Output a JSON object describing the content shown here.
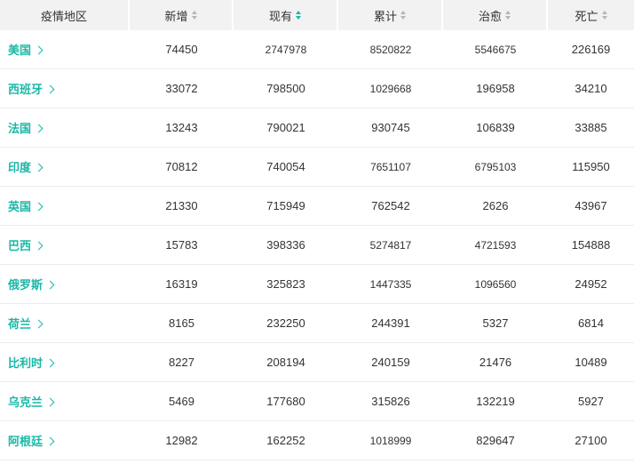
{
  "colors": {
    "accent": "#1ab8a8",
    "header_bg": "#f2f2f2",
    "text": "#333333",
    "row_border": "#ececec"
  },
  "table": {
    "columns": [
      {
        "label": "疫情地区",
        "sortable": false
      },
      {
        "label": "新增",
        "sortable": true,
        "active": false
      },
      {
        "label": "现有",
        "sortable": true,
        "active": true
      },
      {
        "label": "累计",
        "sortable": true,
        "active": false
      },
      {
        "label": "治愈",
        "sortable": true,
        "active": false
      },
      {
        "label": "死亡",
        "sortable": true,
        "active": false
      }
    ],
    "rows": [
      {
        "region": "美国",
        "new": "74450",
        "current": "2747978",
        "total": "8520822",
        "cured": "5546675",
        "dead": "226169"
      },
      {
        "region": "西班牙",
        "new": "33072",
        "current": "798500",
        "total": "1029668",
        "cured": "196958",
        "dead": "34210"
      },
      {
        "region": "法国",
        "new": "13243",
        "current": "790021",
        "total": "930745",
        "cured": "106839",
        "dead": "33885"
      },
      {
        "region": "印度",
        "new": "70812",
        "current": "740054",
        "total": "7651107",
        "cured": "6795103",
        "dead": "115950"
      },
      {
        "region": "英国",
        "new": "21330",
        "current": "715949",
        "total": "762542",
        "cured": "2626",
        "dead": "43967"
      },
      {
        "region": "巴西",
        "new": "15783",
        "current": "398336",
        "total": "5274817",
        "cured": "4721593",
        "dead": "154888"
      },
      {
        "region": "俄罗斯",
        "new": "16319",
        "current": "325823",
        "total": "1447335",
        "cured": "1096560",
        "dead": "24952"
      },
      {
        "region": "荷兰",
        "new": "8165",
        "current": "232250",
        "total": "244391",
        "cured": "5327",
        "dead": "6814"
      },
      {
        "region": "比利时",
        "new": "8227",
        "current": "208194",
        "total": "240159",
        "cured": "21476",
        "dead": "10489"
      },
      {
        "region": "乌克兰",
        "new": "5469",
        "current": "177680",
        "total": "315826",
        "cured": "132219",
        "dead": "5927"
      },
      {
        "region": "阿根廷",
        "new": "12982",
        "current": "162252",
        "total": "1018999",
        "cured": "829647",
        "dead": "27100"
      }
    ]
  }
}
